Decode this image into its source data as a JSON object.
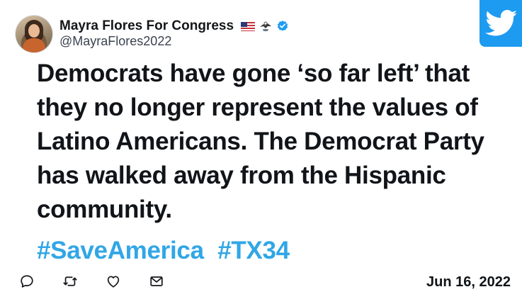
{
  "author": {
    "display_name": "Mayra Flores For Congress",
    "handle": "@MayraFlores2022",
    "badges": [
      "us-flag-icon",
      "eagle-icon",
      "verified-icon"
    ],
    "verified_color": "#1d9bf0"
  },
  "brand": {
    "icon": "twitter-bird-icon",
    "color": "#1d9bf0"
  },
  "tweet": {
    "text_lines": [
      "Democrats have gone ‘so far left’ that",
      "they no longer represent the values of",
      "Latino Americans. The Democrat Party",
      "has walked away from the Hispanic",
      "community."
    ],
    "hashtags": [
      "#SaveAmerica",
      "#TX34"
    ],
    "hashtag_color": "#31a6e6",
    "date": "Jun 16, 2022"
  },
  "actions": [
    {
      "name": "reply",
      "icon": "reply-icon"
    },
    {
      "name": "retweet",
      "icon": "retweet-icon"
    },
    {
      "name": "like",
      "icon": "heart-icon"
    },
    {
      "name": "share",
      "icon": "mail-icon"
    }
  ]
}
